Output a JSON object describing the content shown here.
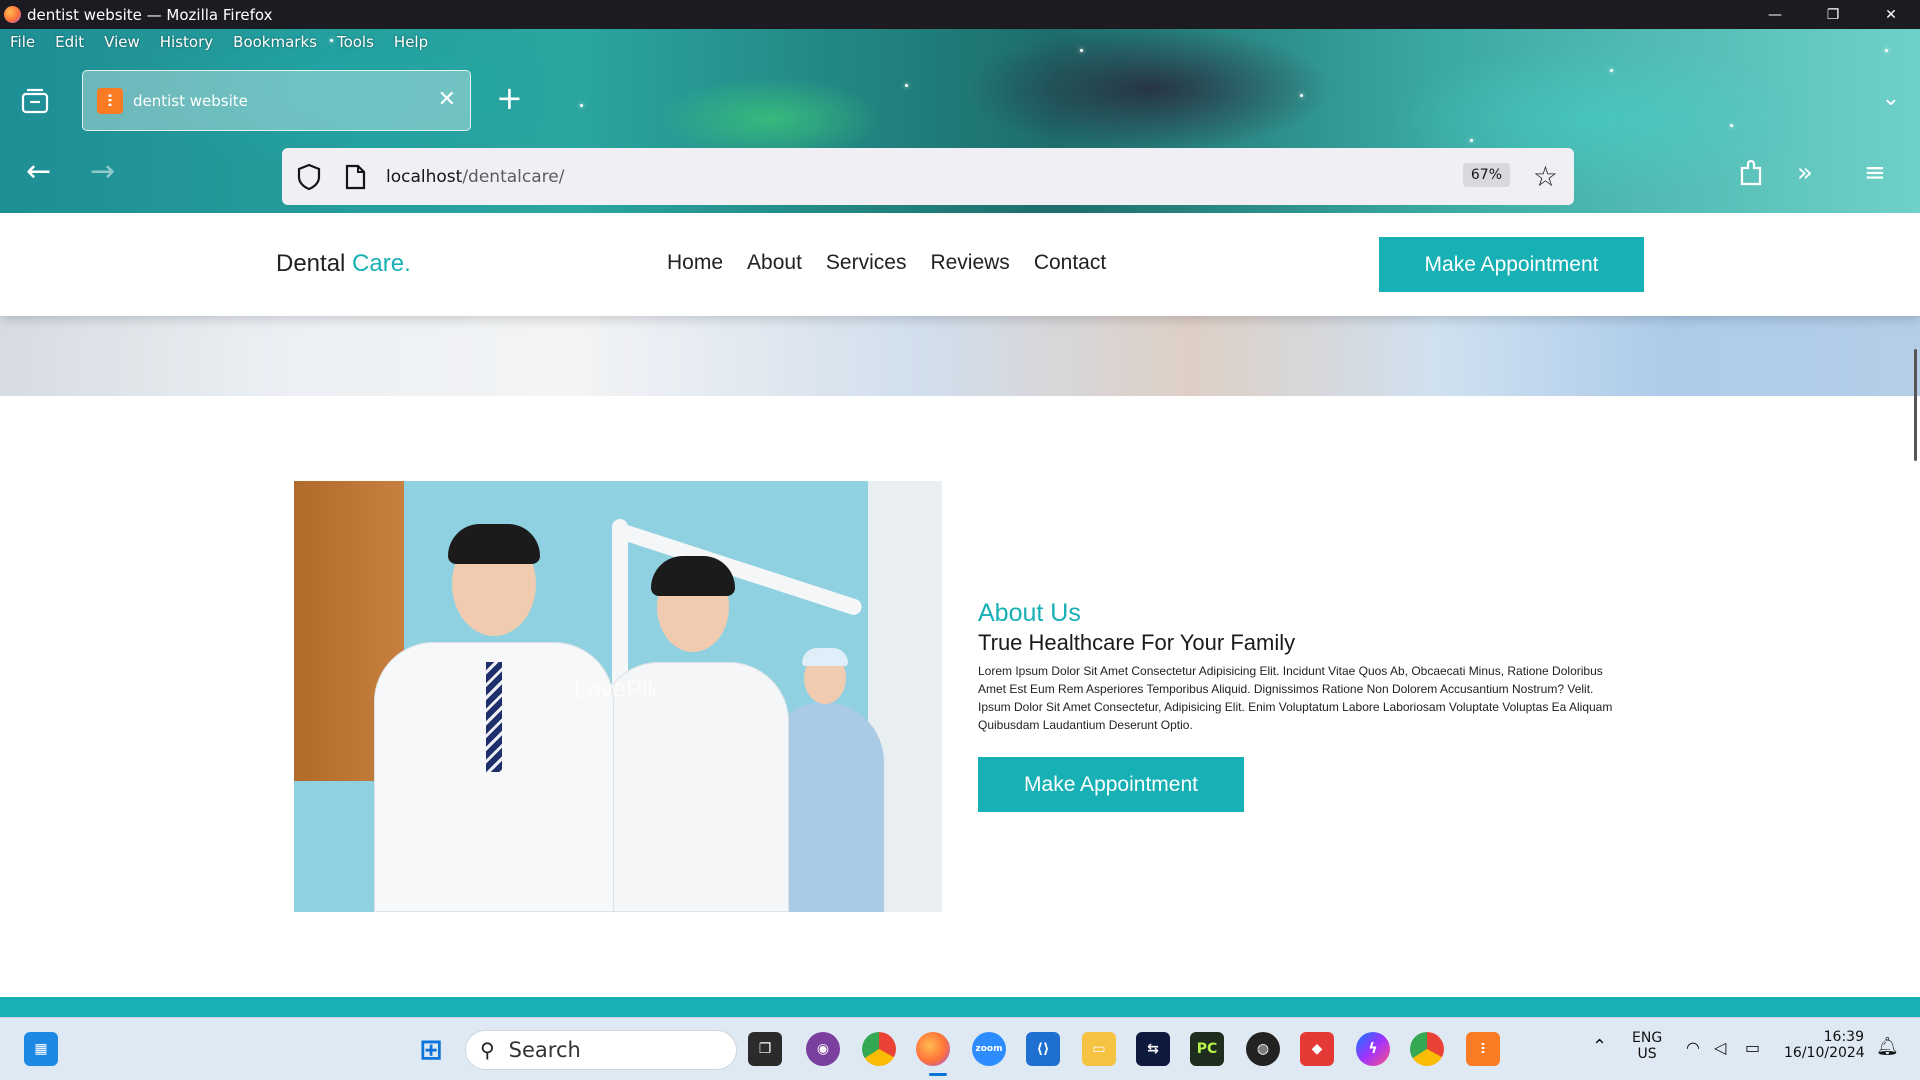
{
  "window": {
    "title": "dentist website — Mozilla Firefox",
    "controls": [
      "—",
      "❐",
      "✕"
    ]
  },
  "menu": [
    "File",
    "Edit",
    "View",
    "History",
    "Bookmarks",
    "Tools",
    "Help"
  ],
  "tab": {
    "title": "dentist website",
    "favicon_glyph": "ⵗ"
  },
  "urlbar": {
    "host": "localhost",
    "path": "/dentalcare/",
    "zoom": "67%"
  },
  "site": {
    "logo_main": "Dental",
    "logo_accent": "Care.",
    "nav": [
      "Home",
      "About",
      "Services",
      "Reviews",
      "Contact"
    ],
    "cta_top": "Make Appointment",
    "accent_color": "#17b0b4"
  },
  "about": {
    "kicker": "About Us",
    "title": "True Healthcare For Your Family",
    "body": "Lorem Ipsum Dolor Sit Amet Consectetur Adipisicing Elit. Incidunt Vitae Quos Ab, Obcaecati Minus, Ratione Doloribus Amet Est Eum Rem Asperiores Temporibus Aliquid. Dignissimos Ratione Non Dolorem Accusantium Nostrum? Velit. Ipsum Dolor Sit Amet Consectetur, Adipisicing Elit. Enim Voluptatum Labore Laboriosam Voluptate Voluptas Ea Aliquam Quibusdam Laudantium Deserunt Optio.",
    "cta": "Make Appointment",
    "image_watermark": "LovePik"
  },
  "taskbar": {
    "search_placeholder": "Search",
    "lang_top": "ENG",
    "lang_bottom": "US",
    "time": "16:39",
    "date": "16/10/2024"
  }
}
